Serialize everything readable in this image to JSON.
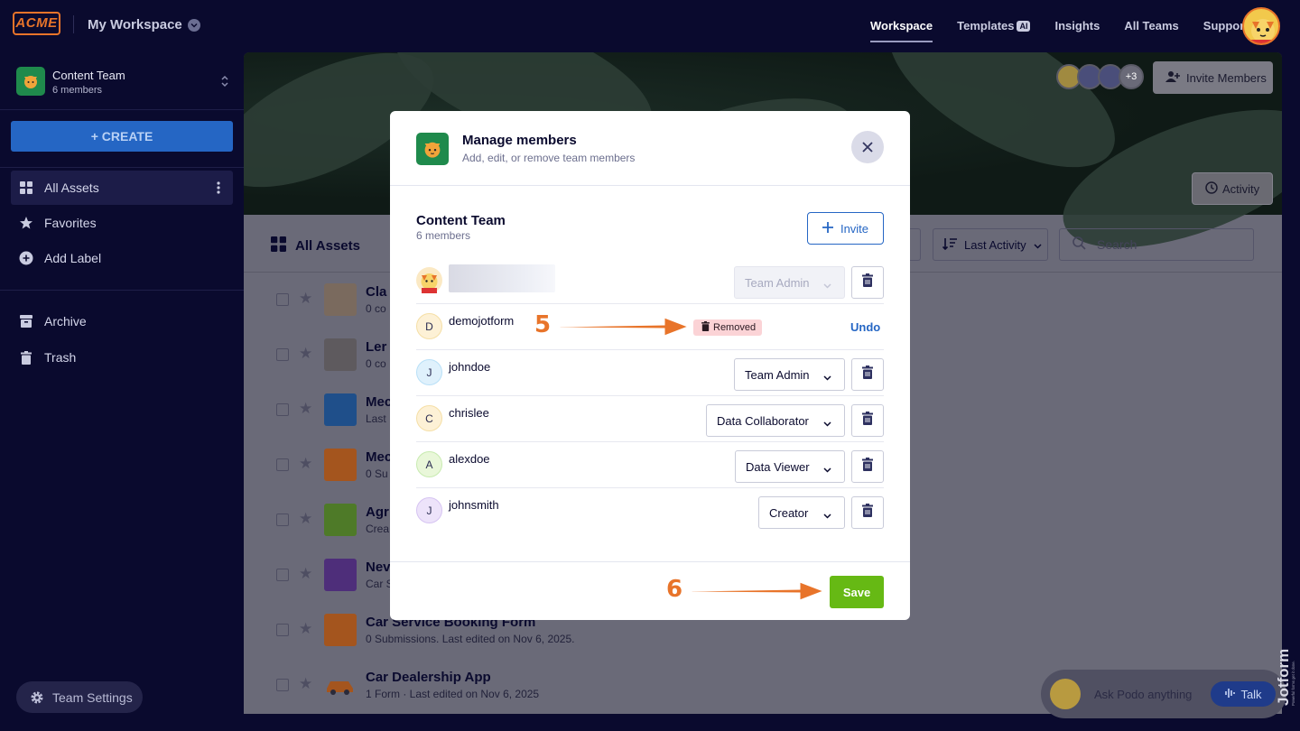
{
  "header": {
    "logo": "ACME",
    "workspace_title": "My Workspace",
    "nav": [
      {
        "label": "Workspace",
        "active": true
      },
      {
        "label": "Templates",
        "badge": "AI"
      },
      {
        "label": "Insights"
      },
      {
        "label": "All Teams"
      },
      {
        "label": "Support"
      }
    ]
  },
  "sidebar": {
    "team_name": "Content Team",
    "team_members": "6 members",
    "create_label": "+ CREATE",
    "items": [
      {
        "label": "All Assets",
        "icon": "grid-icon",
        "active": true
      },
      {
        "label": "Favorites",
        "icon": "star-icon"
      },
      {
        "label": "Add Label",
        "icon": "plus-circle-icon"
      },
      {
        "label": "Archive",
        "icon": "archive-icon"
      },
      {
        "label": "Trash",
        "icon": "trash-icon"
      }
    ],
    "team_settings_label": "Team Settings"
  },
  "main": {
    "invite_members_label": "Invite Members",
    "avatar_overflow": "+3",
    "activity_label": "Activity",
    "assets_title": "All Assets",
    "sort_label": "Last Activity",
    "search_placeholder": "Search",
    "rows": [
      {
        "title": "Cla",
        "sub": "0 co"
      },
      {
        "title": "Ler",
        "sub": "0 co"
      },
      {
        "title": "Mec",
        "sub": "Last"
      },
      {
        "title": "Mec",
        "sub": "0 Su"
      },
      {
        "title": "Agr",
        "sub": "Crea"
      },
      {
        "title": "Nev",
        "sub": "Car S"
      },
      {
        "title": "Car Service Booking Form",
        "sub": "0 Submissions.  Last edited on Nov 6, 2025."
      },
      {
        "title": "Car Dealership App",
        "sub": "1 Form · Last edited on Nov 6, 2025"
      }
    ]
  },
  "chat": {
    "prompt": "Ask Podo anything",
    "talk_label": "Talk",
    "brand": "Jotform",
    "tagline": "Powerful forms get it done."
  },
  "modal": {
    "title": "Manage members",
    "subtitle": "Add, edit, or remove team members",
    "team_name": "Content Team",
    "team_count": "6 members",
    "invite_label": "Invite",
    "members": [
      {
        "initial": "",
        "name": "",
        "role": "Team Admin",
        "role_disabled": true,
        "avatar": "cat"
      },
      {
        "initial": "D",
        "name": "demojotform",
        "removed": true,
        "removed_label": "Removed",
        "undo_label": "Undo",
        "avatar_color": "#fdf1d6"
      },
      {
        "initial": "J",
        "name": "johndoe",
        "role": "Team Admin",
        "avatar_color": "#dff1fc"
      },
      {
        "initial": "C",
        "name": "chrislee",
        "role": "Data Collaborator",
        "avatar_color": "#fdf1d6"
      },
      {
        "initial": "A",
        "name": "alexdoe",
        "role": "Data Viewer",
        "avatar_color": "#e9f7d9"
      },
      {
        "initial": "J",
        "name": "johnsmith",
        "role": "Creator",
        "avatar_color": "#ede3fa"
      }
    ],
    "save_label": "Save"
  },
  "annotations": {
    "step5": "5",
    "step6": "6",
    "color": "#e8742a"
  }
}
